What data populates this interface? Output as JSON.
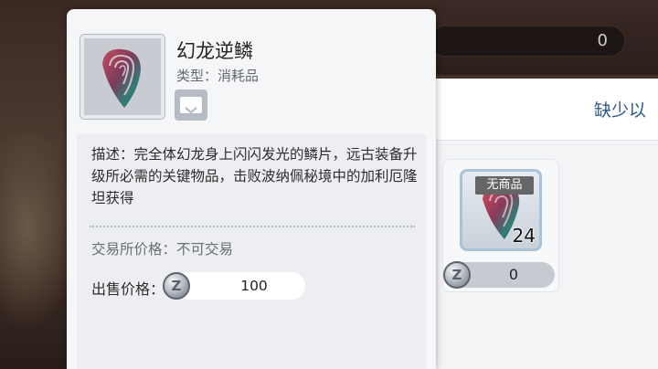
{
  "background": {
    "currency_value": "0",
    "missing_label": "缺少以"
  },
  "tooltip": {
    "title": "幻龙逆鳞",
    "type_label": "类型：消耗品",
    "description": "描述：完全体幻龙身上闪闪发光的鳞片，远古装备升级所必需的关键物品，击败波纳佩秘境中的加利厄隆坦获得",
    "trade_price_label": "交易所价格：不可交易",
    "sell_label": "出售价格：",
    "sell_value": "100",
    "coin_symbol": "Z"
  },
  "item_card": {
    "tag": "无商品",
    "count": "24",
    "price": "0",
    "coin_symbol": "Z"
  },
  "colors": {
    "accent_blue": "#2d5a86",
    "tooltip_bg": "#f5f6f8",
    "slot_border": "#aac2d8"
  },
  "icons": {
    "item": "dragon-scale-icon",
    "chat": "chat-bubble-icon",
    "coin": "zeny-coin-icon"
  }
}
